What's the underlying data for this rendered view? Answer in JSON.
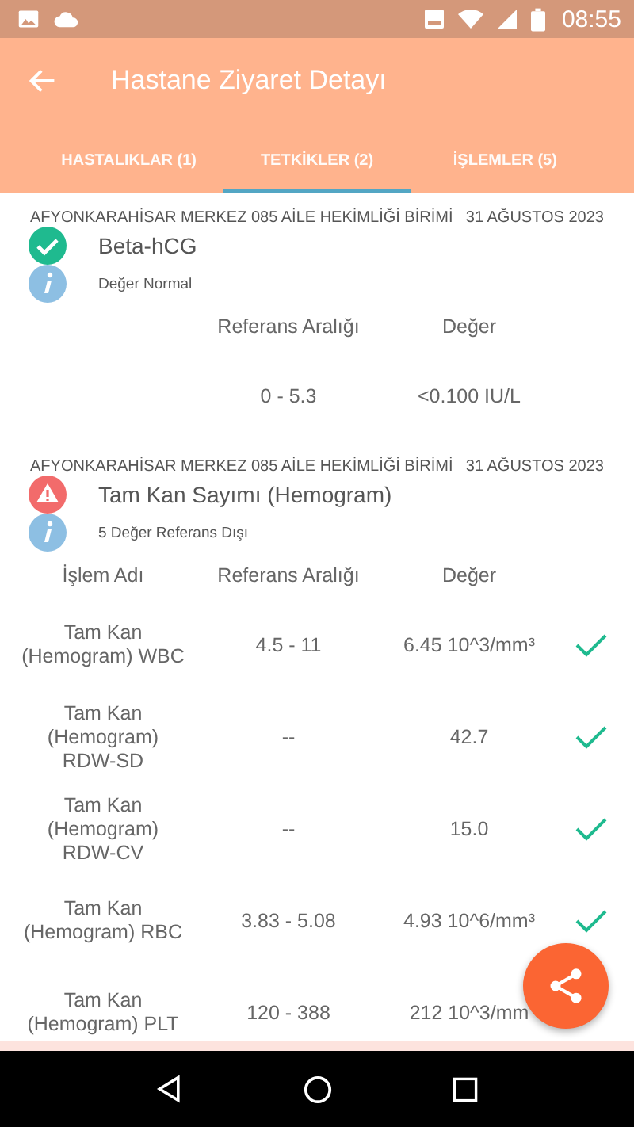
{
  "status_bar": {
    "time": "08:55"
  },
  "app_bar": {
    "title": "Hastane Ziyaret Detayı"
  },
  "tabs": [
    {
      "label": "HASTALIKLAR (1)",
      "selected": false
    },
    {
      "label": "TETKİKLER (2)",
      "selected": true
    },
    {
      "label": "İŞLEMLER (5)",
      "selected": false
    }
  ],
  "tests": [
    {
      "facility": "AFYONKARAHİSAR MERKEZ 085 AİLE HEKİMLİĞİ BİRİMİ",
      "date": "31 AĞUSTOS 2023",
      "name": "Beta-hCG",
      "kind": "normal",
      "note": "Değer Normal",
      "columns": [
        "Referans Aralığı",
        "Değer"
      ],
      "rows": [
        {
          "reference": "0 - 5.3",
          "value": "<0.100 IU/L"
        }
      ]
    },
    {
      "facility": "AFYONKARAHİSAR MERKEZ 085 AİLE HEKİMLİĞİ BİRİMİ",
      "date": "31 AĞUSTOS 2023",
      "name": "Tam Kan Sayımı (Hemogram)",
      "kind": "warning",
      "note": "5 Değer Referans Dışı",
      "columns": [
        "İşlem Adı",
        "Referans Aralığı",
        "Değer"
      ],
      "rows": [
        {
          "name": "Tam Kan (Hemogram) WBC",
          "reference": "4.5 - 11",
          "value": "6.45 10^3/mm³",
          "ok": true
        },
        {
          "name": "Tam Kan (Hemogram) RDW-SD",
          "reference": "--",
          "value": "42.7",
          "ok": true
        },
        {
          "name": "Tam Kan (Hemogram) RDW-CV",
          "reference": "--",
          "value": "15.0",
          "ok": true
        },
        {
          "name": "Tam Kan (Hemogram) RBC",
          "reference": "3.83 - 5.08",
          "value": "4.93 10^6/mm³",
          "ok": true
        },
        {
          "name": "Tam Kan (Hemogram) PLT",
          "reference": "120 - 388",
          "value": "212 10^3/mm"
        }
      ]
    }
  ]
}
